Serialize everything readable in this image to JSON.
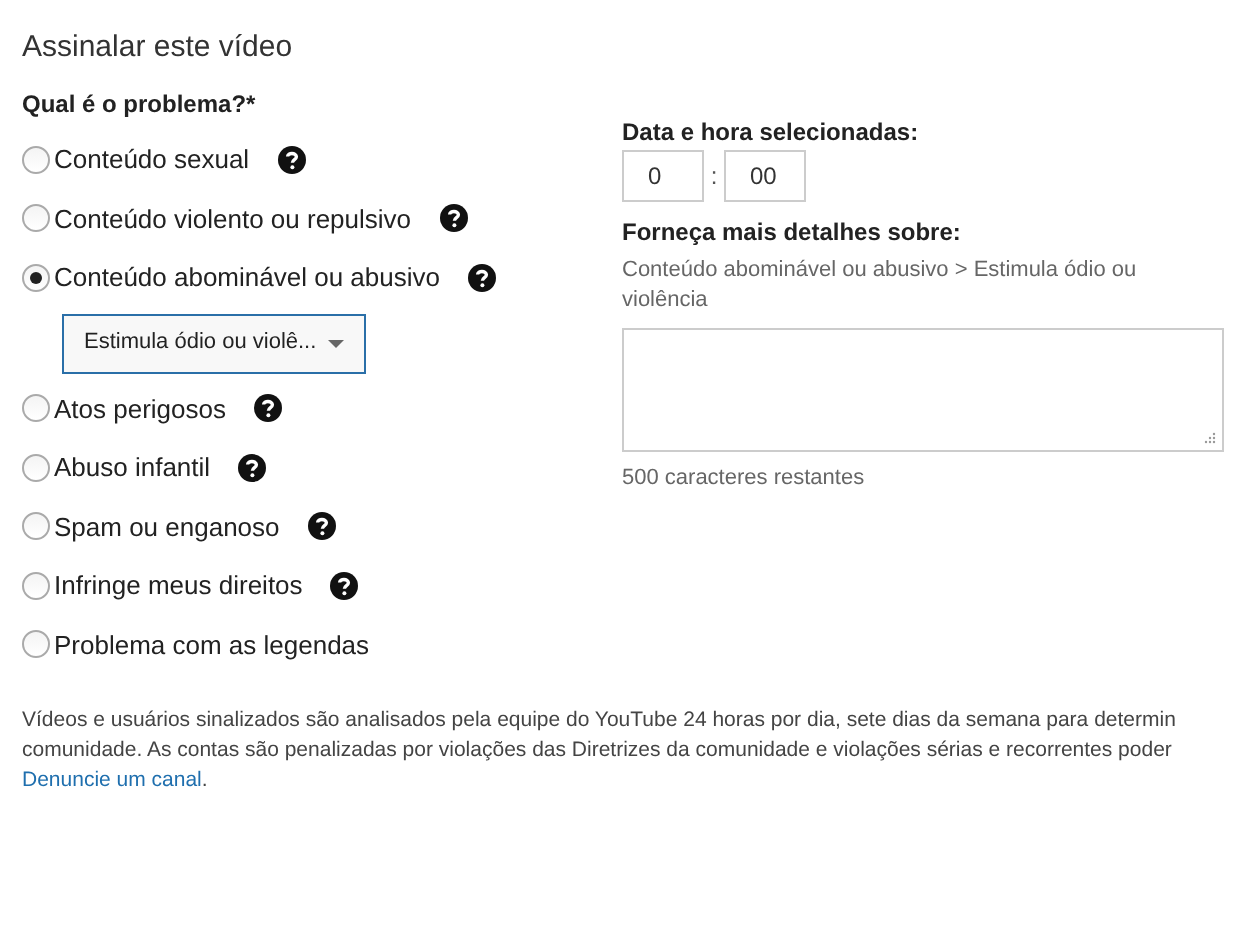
{
  "title": "Assinalar este vídeo",
  "question": "Qual é o problema?*",
  "options": [
    {
      "label": "Conteúdo sexual",
      "selected": false,
      "help": true
    },
    {
      "label": "Conteúdo violento ou repulsivo",
      "selected": false,
      "help": true
    },
    {
      "label": "Conteúdo abominável ou abusivo",
      "selected": true,
      "help": true,
      "dropdown": "Estimula ódio ou violê..."
    },
    {
      "label": "Atos perigosos",
      "selected": false,
      "help": true
    },
    {
      "label": "Abuso infantil",
      "selected": false,
      "help": true
    },
    {
      "label": "Spam ou enganoso",
      "selected": false,
      "help": true
    },
    {
      "label": "Infringe meus direitos",
      "selected": false,
      "help": true
    },
    {
      "label": "Problema com as legendas",
      "selected": false,
      "help": false
    }
  ],
  "time": {
    "label": "Data e hora selecionadas:",
    "minutes": "0",
    "separator": ":",
    "seconds": "00"
  },
  "details": {
    "label": "Forneça mais detalhes sobre:",
    "path": "Conteúdo abominável ou abusivo > Estimula ódio ou violência",
    "remaining": "500 caracteres restantes"
  },
  "notice": {
    "lines": [
      "Vídeos e usuários sinalizados são analisados pela equipe do YouTube 24 horas por dia, sete dias da semana para determin",
      "comunidade. As contas são penalizadas por violações das Diretrizes da comunidade e violações sérias e recorrentes poder"
    ],
    "link": "Denuncie um canal",
    "after_link": "."
  }
}
